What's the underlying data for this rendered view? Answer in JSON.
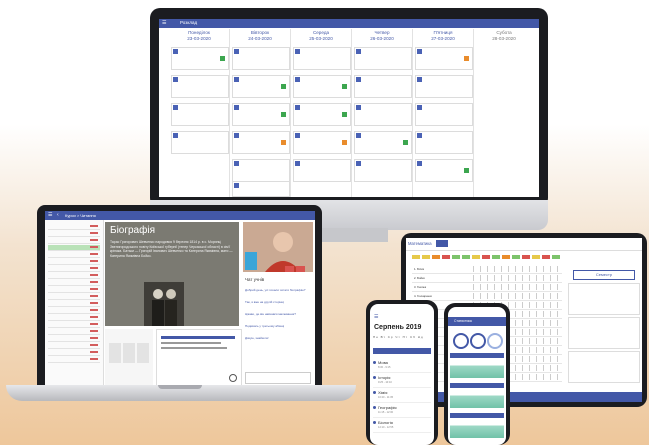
{
  "monitor": {
    "title": "Розклад",
    "days": [
      {
        "name": "Понеділок",
        "date": "23-03-2020"
      },
      {
        "name": "Вівторок",
        "date": "24-03-2020"
      },
      {
        "name": "Середа",
        "date": "25-03-2020"
      },
      {
        "name": "Четвер",
        "date": "26-03-2020"
      },
      {
        "name": "П'ятниця",
        "date": "27-03-2020"
      },
      {
        "name": "Субота",
        "date": "28-03-2020"
      }
    ]
  },
  "laptop": {
    "breadcrumb": "Курси > Читання",
    "bio_title": "Біографія",
    "bio_text": "Тарас Григорович Шевченко народився 9 березня 1814 р. в с. Моринці Звенигородського повіту Київської губернії (тепер Черкаської області) в сім'ї кріпака. Батьки — Григорій Іванович Шевченко та Катерина Якимівна, мати — Катерина Якимівна Бойко.",
    "chat_title": "Чат учнів",
    "chat_messages": [
      "Добрий день, усі почали читати біографію?",
      "Так, я вже на другій сторінці",
      "Цікаво, де він навчався малювання?",
      "Подивись у третьому абзаці",
      "Дякую, знайшла!"
    ]
  },
  "tablet": {
    "title": "Математика",
    "semester_button": "Семестр",
    "students": [
      "1. Білик",
      "2. Бойко",
      "3. Гнатюк",
      "4. Гончаренко",
      "5. Данилюк",
      "6. Захарченко",
      "7. Іваненко",
      "8. Коваль",
      "9. Кравчук",
      "10. Лисенко",
      "11. Мельник",
      "12. Олійник",
      "13. Ткаченко"
    ]
  },
  "phone1": {
    "month": "Серпень 2019",
    "week": "Пн Вт Ср Чт Пт Сб Нд",
    "items": [
      {
        "title": "Мова",
        "sub": "8:30 - 9:15"
      },
      {
        "title": "Історія",
        "sub": "9:25 - 10:10"
      },
      {
        "title": "Хімія",
        "sub": "10:20 - 11:05"
      },
      {
        "title": "Географія",
        "sub": "11:15 - 12:00"
      },
      {
        "title": "Біологія",
        "sub": "12:10 - 12:55"
      }
    ]
  },
  "phone2": {
    "title": "Статистика"
  },
  "colors": {
    "accent": "#4358a7"
  }
}
